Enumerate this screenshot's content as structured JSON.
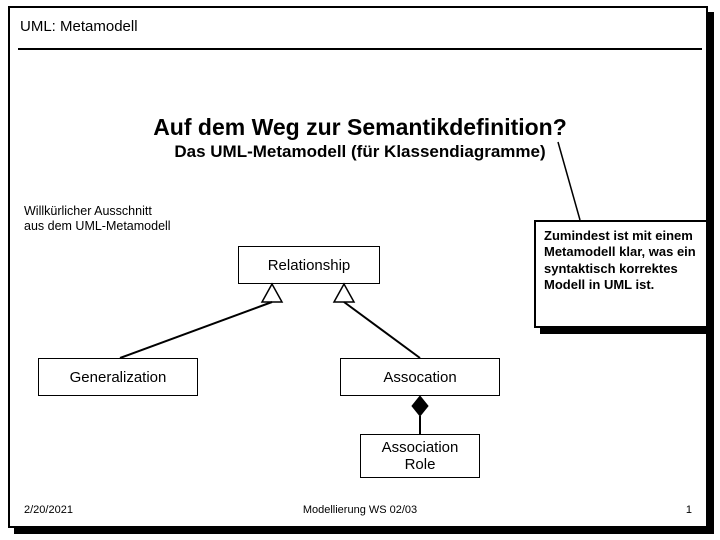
{
  "header": {
    "label": "UML: Metamodell"
  },
  "title": "Auf dem Weg zur Semantikdefinition?",
  "subtitle": "Das UML-Metamodell (für Klassendiagramme)",
  "excerpt_note": {
    "line1": "Willkürlicher Ausschnitt",
    "line2": "aus dem UML-Metamodell"
  },
  "uml": {
    "relationship": "Relationship",
    "generalization": "Generalization",
    "association": "Assocation",
    "association_role_line1": "Association",
    "association_role_line2": "Role"
  },
  "callout": "Zumindest ist mit einem Metamodell klar, was ein syntaktisch korrektes Modell  in UML ist.",
  "footer": {
    "date": "2/20/2021",
    "center": "Modellierung WS 02/03",
    "page": "1"
  }
}
